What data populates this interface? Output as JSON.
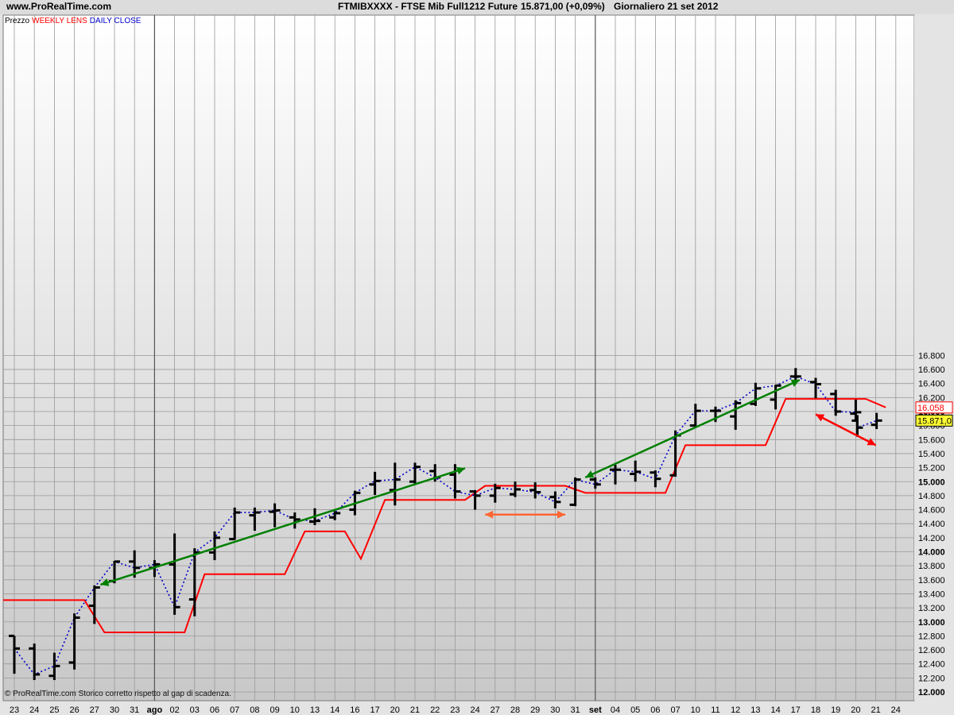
{
  "header": {
    "site": "www.ProRealTime.com",
    "title": "FTMIBXXXX - FTSE Mib Full1212 Future",
    "price_info": "15.871,00 (+0,09%)",
    "period_info": "Giornaliero  21 set 2012"
  },
  "legend": {
    "label": "Prezzo",
    "weekly_lens": "WEEKLY LENS",
    "daily_close": "DAILY CLOSE",
    "weekly_color": "#ff0000",
    "daily_color": "#0000cc"
  },
  "footer": {
    "note": "© ProRealTime.com  Storico corretto rispetto al gap di scadenza."
  },
  "price_labels": {
    "weekly_lens_last": "16.058",
    "last_close": "15.871,0"
  },
  "chart_data": {
    "type": "ohlc",
    "x_tick_labels": [
      "23",
      "24",
      "25",
      "26",
      "27",
      "30",
      "31",
      "ago",
      "02",
      "03",
      "06",
      "07",
      "08",
      "09",
      "10",
      "13",
      "14",
      "16",
      "17",
      "20",
      "21",
      "22",
      "23",
      "24",
      "27",
      "28",
      "29",
      "30",
      "31",
      "set",
      "04",
      "05",
      "06",
      "07",
      "10",
      "11",
      "12",
      "13",
      "14",
      "17",
      "18",
      "19",
      "20",
      "21",
      "24"
    ],
    "bold_x_labels": [
      "ago",
      "set"
    ],
    "y_ticks": [
      12000,
      12200,
      12400,
      12600,
      12800,
      13000,
      13200,
      13400,
      13600,
      13800,
      14000,
      14200,
      14400,
      14600,
      14800,
      15000,
      15200,
      15400,
      15600,
      15800,
      16000,
      16200,
      16400,
      16600,
      16800
    ],
    "y_tick_labels": [
      "12.000",
      "12.200",
      "12.400",
      "12.600",
      "12.800",
      "13.000",
      "13.200",
      "13.400",
      "13.600",
      "13.800",
      "14.000",
      "14.200",
      "14.400",
      "14.600",
      "14.800",
      "15.000",
      "15.200",
      "15.400",
      "15.600",
      "15.800",
      "16.000",
      "16.200",
      "16.400",
      "16.600",
      "16.800"
    ],
    "bold_y_ticks": [
      12000,
      13000,
      14000,
      15000,
      16000
    ],
    "ylim": [
      12000,
      16850
    ],
    "bars": [
      {
        "x": "23",
        "o": 12800,
        "h": 12800,
        "l": 12260,
        "c": 12620
      },
      {
        "x": "24",
        "o": 12620,
        "h": 12690,
        "l": 12170,
        "c": 12250
      },
      {
        "x": "25",
        "o": 12230,
        "h": 12560,
        "l": 12170,
        "c": 12370
      },
      {
        "x": "26",
        "o": 12420,
        "h": 13120,
        "l": 12320,
        "c": 13060
      },
      {
        "x": "27",
        "o": 13230,
        "h": 13520,
        "l": 12970,
        "c": 13490
      },
      {
        "x": "30",
        "o": 13580,
        "h": 13870,
        "l": 13550,
        "c": 13860
      },
      {
        "x": "31",
        "o": 13860,
        "h": 14020,
        "l": 13630,
        "c": 13770
      },
      {
        "x": "ago",
        "o": 13770,
        "h": 13880,
        "l": 13640,
        "c": 13820
      },
      {
        "x": "02",
        "o": 13820,
        "h": 14260,
        "l": 13100,
        "c": 13210
      },
      {
        "x": "03",
        "o": 13320,
        "h": 14050,
        "l": 13080,
        "c": 13990
      },
      {
        "x": "06",
        "o": 13990,
        "h": 14290,
        "l": 13880,
        "c": 14200
      },
      {
        "x": "07",
        "o": 14180,
        "h": 14630,
        "l": 14170,
        "c": 14560
      },
      {
        "x": "08",
        "o": 14520,
        "h": 14630,
        "l": 14300,
        "c": 14560
      },
      {
        "x": "09",
        "o": 14570,
        "h": 14690,
        "l": 14350,
        "c": 14590
      },
      {
        "x": "10",
        "o": 14490,
        "h": 14560,
        "l": 14330,
        "c": 14460
      },
      {
        "x": "13",
        "o": 14430,
        "h": 14620,
        "l": 14380,
        "c": 14440
      },
      {
        "x": "14",
        "o": 14490,
        "h": 14580,
        "l": 14450,
        "c": 14550
      },
      {
        "x": "16",
        "o": 14600,
        "h": 14870,
        "l": 14520,
        "c": 14840
      },
      {
        "x": "17",
        "o": 14960,
        "h": 15140,
        "l": 14810,
        "c": 15010
      },
      {
        "x": "20",
        "o": 14880,
        "h": 15270,
        "l": 14660,
        "c": 15030
      },
      {
        "x": "21",
        "o": 15000,
        "h": 15270,
        "l": 14960,
        "c": 15210
      },
      {
        "x": "22",
        "o": 15150,
        "h": 15250,
        "l": 15000,
        "c": 15060
      },
      {
        "x": "23",
        "o": 15100,
        "h": 15250,
        "l": 14760,
        "c": 14860
      },
      {
        "x": "24",
        "o": 14860,
        "h": 14880,
        "l": 14600,
        "c": 14800
      },
      {
        "x": "27",
        "o": 14800,
        "h": 14970,
        "l": 14700,
        "c": 14910
      },
      {
        "x": "28",
        "o": 14820,
        "h": 15000,
        "l": 14780,
        "c": 14890
      },
      {
        "x": "29",
        "o": 14880,
        "h": 14990,
        "l": 14760,
        "c": 14850
      },
      {
        "x": "30",
        "o": 14780,
        "h": 14860,
        "l": 14620,
        "c": 14710
      },
      {
        "x": "31",
        "o": 14670,
        "h": 15060,
        "l": 14650,
        "c": 15030
      },
      {
        "x": "set",
        "o": 15030,
        "h": 15060,
        "l": 14900,
        "c": 14960
      },
      {
        "x": "04",
        "o": 15170,
        "h": 15240,
        "l": 14960,
        "c": 15170
      },
      {
        "x": "05",
        "o": 15110,
        "h": 15300,
        "l": 15000,
        "c": 15140
      },
      {
        "x": "06",
        "o": 15130,
        "h": 15160,
        "l": 14920,
        "c": 15040
      },
      {
        "x": "07",
        "o": 15090,
        "h": 15730,
        "l": 15070,
        "c": 15660
      },
      {
        "x": "10",
        "o": 15800,
        "h": 16110,
        "l": 15780,
        "c": 16010
      },
      {
        "x": "11",
        "o": 16010,
        "h": 16070,
        "l": 15850,
        "c": 16010
      },
      {
        "x": "12",
        "o": 15930,
        "h": 16160,
        "l": 15740,
        "c": 16120
      },
      {
        "x": "13",
        "o": 16110,
        "h": 16410,
        "l": 16080,
        "c": 16330
      },
      {
        "x": "14",
        "o": 16170,
        "h": 16380,
        "l": 16030,
        "c": 16370
      },
      {
        "x": "17",
        "o": 16500,
        "h": 16620,
        "l": 16450,
        "c": 16500
      },
      {
        "x": "18",
        "o": 16420,
        "h": 16480,
        "l": 16190,
        "c": 16390
      },
      {
        "x": "19",
        "o": 16250,
        "h": 16310,
        "l": 15940,
        "c": 16000
      },
      {
        "x": "20",
        "o": 15970,
        "h": 16170,
        "l": 15860,
        "c": 15990
      },
      {
        "x": "21",
        "o": 15870,
        "h": 15950,
        "l": 15640,
        "c": 15770
      },
      {
        "x": "21b",
        "o": 15810,
        "h": 15980,
        "l": 15750,
        "c": 15871
      }
    ],
    "weekly_lens": [
      {
        "i": 0,
        "y": 13310
      },
      {
        "i": 3.5,
        "y": 13310
      },
      {
        "i": 4.5,
        "y": 12850
      },
      {
        "i": 8.5,
        "y": 12850
      },
      {
        "i": 9.5,
        "y": 13680
      },
      {
        "i": 13.5,
        "y": 13680
      },
      {
        "i": 14.5,
        "y": 14290
      },
      {
        "i": 16.5,
        "y": 14290
      },
      {
        "i": 17.3,
        "y": 13900
      },
      {
        "i": 18.5,
        "y": 14740
      },
      {
        "i": 22.5,
        "y": 14740
      },
      {
        "i": 23.5,
        "y": 14940
      },
      {
        "i": 27.5,
        "y": 14940
      },
      {
        "i": 28.5,
        "y": 14840
      },
      {
        "i": 32.5,
        "y": 14840
      },
      {
        "i": 33.5,
        "y": 15520
      },
      {
        "i": 37.5,
        "y": 15520
      },
      {
        "i": 38.5,
        "y": 16180
      },
      {
        "i": 42.5,
        "y": 16180
      },
      {
        "i": 43.5,
        "y": 16058
      }
    ],
    "trend_lines": [
      {
        "color": "#008000",
        "from": {
          "i": 4.3,
          "y": 13530
        },
        "to": {
          "i": 22.5,
          "y": 15190
        }
      },
      {
        "color": "#ff6633",
        "from": {
          "i": 23.5,
          "y": 14530
        },
        "to": {
          "i": 27.5,
          "y": 14530
        }
      },
      {
        "color": "#008000",
        "from": {
          "i": 28.5,
          "y": 15060
        },
        "to": {
          "i": 39.2,
          "y": 16450
        }
      },
      {
        "color": "#ff0000",
        "from": {
          "i": 40,
          "y": 15960
        },
        "to": {
          "i": 43,
          "y": 15520
        }
      }
    ]
  }
}
